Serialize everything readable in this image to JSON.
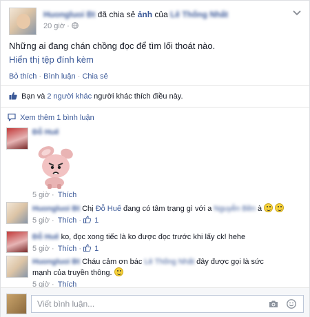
{
  "post": {
    "author": "Huongluoi Bt",
    "shared_text": "đã chia sẻ",
    "object": "ảnh",
    "of_text": "của",
    "owner": "Lê Thống Nhất",
    "time": "20 giờ",
    "separator": "·",
    "body": "Những ai đang chán chồng đọc để tìm lối thoát nào.",
    "attachment_link": "Hiển thị tệp đính kèm"
  },
  "actions": {
    "unlike": "Bỏ thích",
    "comment": "Bình luận",
    "share": "Chia sẻ",
    "dot": "·"
  },
  "likes": {
    "you_and": "Bạn và",
    "others": "2 người khác",
    "suffix": "người khác thích điều này."
  },
  "more_comments": "Xem thêm 1 bình luận",
  "comments": [
    {
      "author": "Đỗ Huế",
      "time": "5 giờ",
      "like": "Thích",
      "has_sticker": true
    },
    {
      "author": "Huongluoi Bt",
      "text_prefix": "Chị",
      "mention": "Đỗ Huế",
      "text_mid": "đang có tâm trạng gì với a",
      "mention2": "Nguyễn Bền",
      "text_suffix": "à",
      "time": "5 giờ",
      "like": "Thích",
      "like_count": "1"
    },
    {
      "author": "Đỗ Huế",
      "text": "ko, đọc xong tiếc là ko được đọc trước khi lấy ck! hehe",
      "time": "5 giờ",
      "like": "Thích",
      "like_count": "1"
    },
    {
      "author": "Huongluoi Bt",
      "text_prefix": "Cháu cảm ơn bác",
      "mention": "Lê Thống Nhất",
      "text_suffix": "đây được gọi là sức mạnh của truyền thông.",
      "time": "5 giờ",
      "like": "Thích"
    }
  ],
  "composer": {
    "placeholder": "Viết bình luận..."
  },
  "icons": {
    "chevron": "chevron-down-icon",
    "globe": "globe-icon",
    "thumb": "thumbs-up-icon",
    "speech": "speech-bubble-icon",
    "camera": "camera-icon",
    "smiley": "smiley-icon"
  },
  "colors": {
    "link": "#3b5998",
    "meta": "#90949c",
    "text": "#141823"
  }
}
